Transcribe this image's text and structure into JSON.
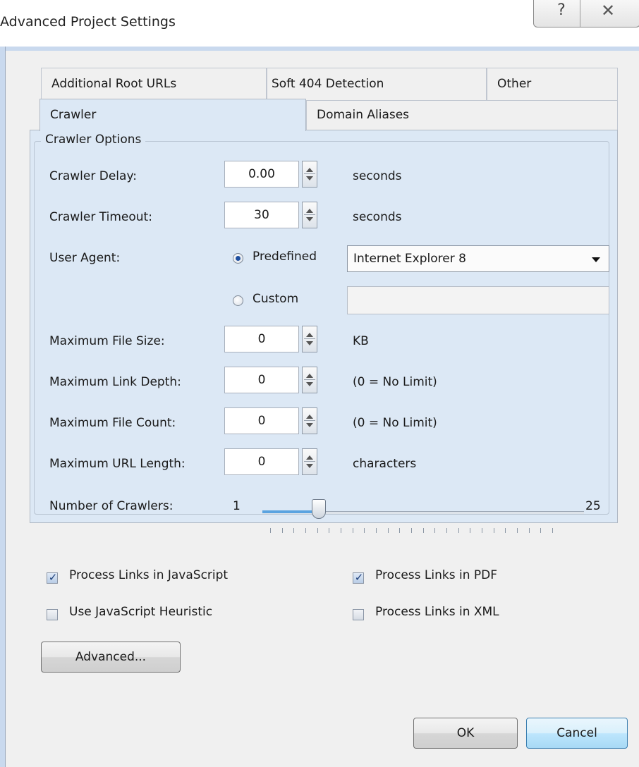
{
  "window": {
    "title": "Advanced Project Settings",
    "help_glyph": "?",
    "close_glyph": "✕"
  },
  "tabs": {
    "row1": [
      "Additional Root URLs",
      "Soft 404 Detection",
      "Other"
    ],
    "row2": [
      "Crawler",
      "Domain Aliases"
    ],
    "active": "Crawler"
  },
  "crawler_options": {
    "group_title": "Crawler Options",
    "crawler_delay": {
      "label": "Crawler Delay:",
      "value": "0.00",
      "unit": "seconds"
    },
    "crawler_timeout": {
      "label": "Crawler Timeout:",
      "value": "30",
      "unit": "seconds"
    },
    "user_agent": {
      "label": "User Agent:",
      "predefined_label": "Predefined",
      "custom_label": "Custom",
      "selected_mode": "Predefined",
      "predefined_value": "Internet Explorer 8",
      "custom_value": ""
    },
    "max_file_size": {
      "label": "Maximum File Size:",
      "value": "0",
      "unit": "KB"
    },
    "max_link_depth": {
      "label": "Maximum Link Depth:",
      "value": "0",
      "unit": "(0 = No Limit)"
    },
    "max_file_count": {
      "label": "Maximum File Count:",
      "value": "0",
      "unit": "(0 = No Limit)"
    },
    "max_url_length": {
      "label": "Maximum URL Length:",
      "value": "0",
      "unit": "characters"
    },
    "num_crawlers": {
      "label": "Number of Crawlers:",
      "min": "1",
      "max": "25",
      "value": 4
    },
    "checkboxes": {
      "process_js": {
        "label": "Process Links in JavaScript",
        "checked": true
      },
      "process_pdf": {
        "label": "Process Links in PDF",
        "checked": true
      },
      "js_heuristic": {
        "label": "Use JavaScript Heuristic",
        "checked": false
      },
      "process_xml": {
        "label": "Process Links in XML",
        "checked": false
      }
    },
    "advanced_button": "Advanced..."
  },
  "footer": {
    "ok": "OK",
    "cancel": "Cancel"
  },
  "colors": {
    "panel": "#dce8f5",
    "accent": "#3c7fb1",
    "slider_fill": "#5aa3e0"
  }
}
